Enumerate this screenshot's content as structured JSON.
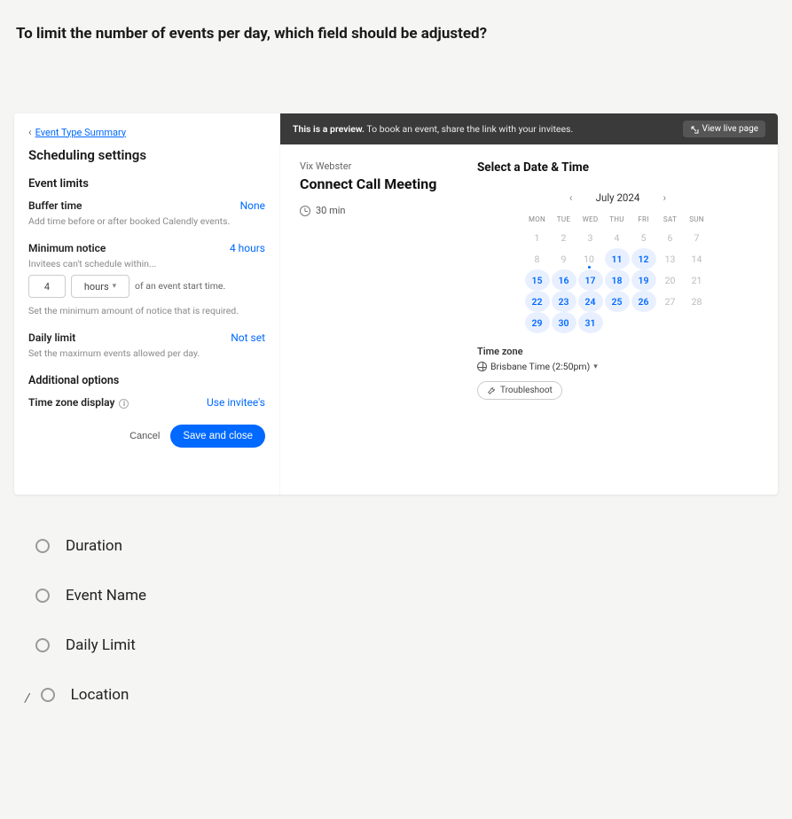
{
  "question": "To limit the number of events per day, which field should be adjusted?",
  "breadcrumb": {
    "back_label": "Event Type Summary"
  },
  "settings": {
    "title": "Scheduling settings",
    "event_limits_heading": "Event limits",
    "buffer": {
      "label": "Buffer time",
      "value": "None",
      "desc": "Add time before or after booked Calendly events."
    },
    "min_notice": {
      "label": "Minimum notice",
      "value": "4 hours",
      "sub": "Invitees can't schedule within...",
      "num": "4",
      "unit": "hours",
      "after": "of an event start time.",
      "desc": "Set the minimum amount of notice that is required."
    },
    "daily_limit": {
      "label": "Daily limit",
      "value": "Not set",
      "desc": "Set the maximum events allowed per day."
    },
    "additional_heading": "Additional options",
    "tz_display": {
      "label": "Time zone display",
      "value": "Use invitee's"
    },
    "cancel": "Cancel",
    "save": "Save and close"
  },
  "preview": {
    "bar_strong": "This is a preview.",
    "bar_rest": " To book an event, share the link with your invitees.",
    "view_live": "View live page",
    "host": "Vix Webster",
    "meeting_title": "Connect Call Meeting",
    "duration": "30 min",
    "select_heading": "Select a Date & Time",
    "month": "July 2024",
    "dow": [
      "MON",
      "TUE",
      "WED",
      "THU",
      "FRI",
      "SAT",
      "SUN"
    ],
    "weeks": [
      [
        {
          "n": "1",
          "a": false
        },
        {
          "n": "2",
          "a": false
        },
        {
          "n": "3",
          "a": false
        },
        {
          "n": "4",
          "a": false
        },
        {
          "n": "5",
          "a": false
        },
        {
          "n": "6",
          "a": false
        },
        {
          "n": "7",
          "a": false
        }
      ],
      [
        {
          "n": "8",
          "a": false
        },
        {
          "n": "9",
          "a": false
        },
        {
          "n": "10",
          "a": false,
          "today": true
        },
        {
          "n": "11",
          "a": true
        },
        {
          "n": "12",
          "a": true
        },
        {
          "n": "13",
          "a": false
        },
        {
          "n": "14",
          "a": false
        }
      ],
      [
        {
          "n": "15",
          "a": true
        },
        {
          "n": "16",
          "a": true
        },
        {
          "n": "17",
          "a": true
        },
        {
          "n": "18",
          "a": true
        },
        {
          "n": "19",
          "a": true
        },
        {
          "n": "20",
          "a": false
        },
        {
          "n": "21",
          "a": false
        }
      ],
      [
        {
          "n": "22",
          "a": true
        },
        {
          "n": "23",
          "a": true
        },
        {
          "n": "24",
          "a": true
        },
        {
          "n": "25",
          "a": true
        },
        {
          "n": "26",
          "a": true
        },
        {
          "n": "27",
          "a": false
        },
        {
          "n": "28",
          "a": false
        }
      ],
      [
        {
          "n": "29",
          "a": true
        },
        {
          "n": "30",
          "a": true
        },
        {
          "n": "31",
          "a": true
        },
        {
          "n": "",
          "a": false
        },
        {
          "n": "",
          "a": false
        },
        {
          "n": "",
          "a": false
        },
        {
          "n": "",
          "a": false
        }
      ]
    ],
    "tz_label": "Time zone",
    "tz_value": "Brisbane Time (2:50pm)",
    "troubleshoot": "Troubleshoot"
  },
  "options": [
    "Duration",
    "Event Name",
    "Daily Limit",
    "Location"
  ]
}
